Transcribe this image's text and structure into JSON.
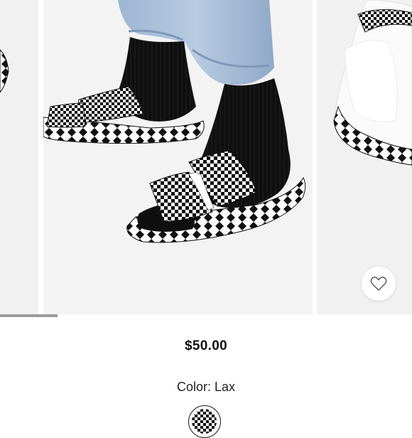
{
  "product": {
    "price": "$50.00",
    "color_label": "Color: Lax",
    "colors": {
      "accent": "#111111",
      "background": "#ffffff"
    }
  },
  "carousel": {
    "progress_fraction": 0.14,
    "images": [
      "sandal-side-left",
      "model-wearing-sandals",
      "sandal-footbed-close-up"
    ]
  },
  "icons": {
    "favorite": "heart-outline-icon"
  }
}
